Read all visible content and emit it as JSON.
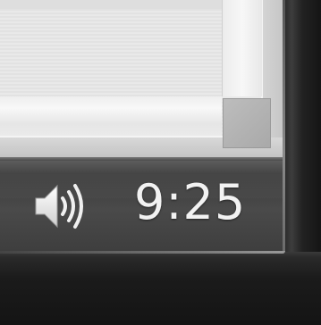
{
  "window": {
    "content": "",
    "resize_grip_icon": "resize-grip"
  },
  "taskbar": {
    "volume": {
      "icon": "speaker-volume-icon"
    },
    "clock": {
      "time": "9:25"
    }
  },
  "colors": {
    "bezel": "#1b1b1b",
    "taskbar": "#3e3e3e",
    "window_background": "#e6e6e6",
    "clock_text": "#f2f2f2"
  }
}
